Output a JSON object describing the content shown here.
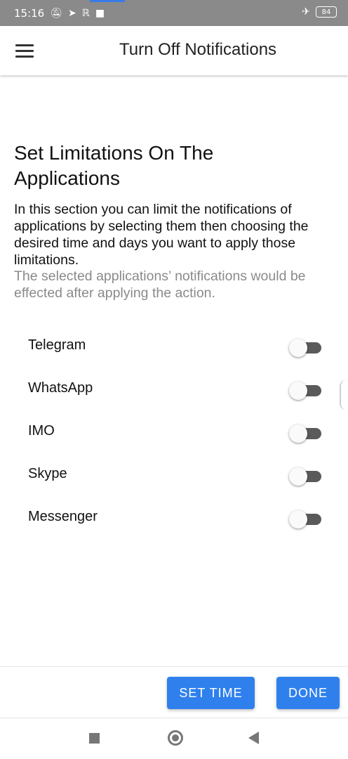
{
  "status_bar": {
    "time": "15:16",
    "battery": "84"
  },
  "toolbar": {
    "title": "Turn Off Notifications"
  },
  "section": {
    "title": "Set Limitations On The Applications",
    "description": "In this section you can limit the notifications of applications by selecting them then choosing the desired time and days you want to apply those limitations.",
    "note": "The selected applications’ notifications would be effected after applying the action."
  },
  "apps": [
    {
      "label": "Telegram",
      "enabled": false
    },
    {
      "label": "WhatsApp",
      "enabled": false
    },
    {
      "label": "IMO",
      "enabled": false
    },
    {
      "label": "Skype",
      "enabled": false
    },
    {
      "label": "Messenger",
      "enabled": false
    }
  ],
  "actions": {
    "set_time_label": "SET TIME",
    "done_label": "DONE"
  },
  "colors": {
    "accent": "#2f80ed",
    "status_bar": "#8a8a8a",
    "toggle_track_off": "#5a5a5a"
  }
}
